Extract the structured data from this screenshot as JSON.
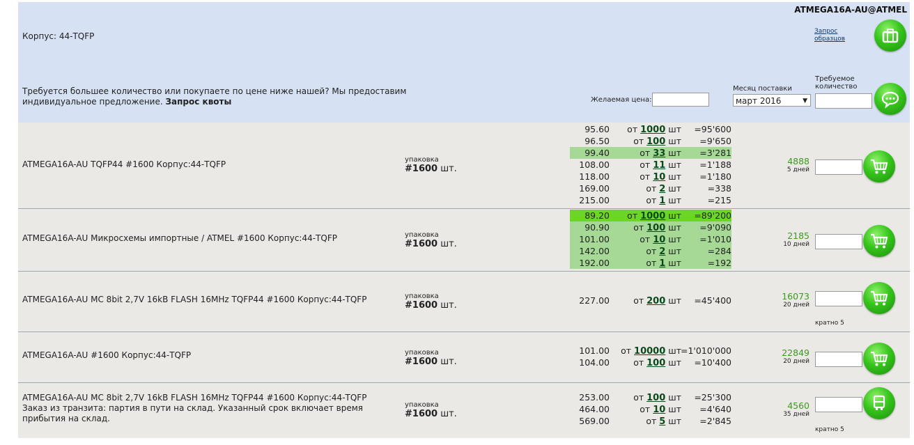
{
  "header": {
    "part_title": "ATMEGA16A-AU@ATMEL",
    "package": "Корпус: 44-TQFP",
    "samples_link_line1": "Запрос",
    "samples_link_line2": "образцов",
    "quote_text": "Требуется большее количество или покупаете по цене ниже нашей? Мы предоставим индивидуальное предложение.",
    "quote_link": "Запрос квоты",
    "desired_price_label": "Желаемая цена:",
    "delivery_month_label": "Месяц поставки",
    "delivery_month_value": "март 2016",
    "required_qty_label": "Требуемое количество"
  },
  "offers": [
    {
      "description": "ATMEGA16A-AU TQFP44 #1600 Корпус:44-TQFP",
      "pack_label": "упаковка",
      "pack_value": "#1600",
      "pack_unit": "шт.",
      "prices": [
        {
          "price": "95.60",
          "from": "от",
          "qty": "1000",
          "unit": "шт",
          "total": "=95'600"
        },
        {
          "price": "96.50",
          "from": "от",
          "qty": "100",
          "unit": "шт",
          "total": "=9'650"
        },
        {
          "price": "99.40",
          "from": "от",
          "qty": "33",
          "unit": "шт",
          "total": "=3'281"
        },
        {
          "price": "108.00",
          "from": "от",
          "qty": "11",
          "unit": "шт",
          "total": "=1'188"
        },
        {
          "price": "118.00",
          "from": "от",
          "qty": "10",
          "unit": "шт",
          "total": "=1'180"
        },
        {
          "price": "169.00",
          "from": "от",
          "qty": "2",
          "unit": "шт",
          "total": "=338"
        },
        {
          "price": "215.00",
          "from": "от",
          "qty": "1",
          "unit": "шт",
          "total": "=215"
        }
      ],
      "stock": "4888",
      "days": "5 дней",
      "multiple": ""
    },
    {
      "description": "ATMEGA16A-AU Микросхемы импортные / ATMEL #1600 Корпус:44-TQFP",
      "pack_label": "упаковка",
      "pack_value": "#1600",
      "pack_unit": "шт.",
      "prices": [
        {
          "price": "89.20",
          "from": "от",
          "qty": "1000",
          "unit": "шт",
          "total": "=89'200"
        },
        {
          "price": "90.90",
          "from": "от",
          "qty": "100",
          "unit": "шт",
          "total": "=9'090"
        },
        {
          "price": "101.00",
          "from": "от",
          "qty": "10",
          "unit": "шт",
          "total": "=1'010"
        },
        {
          "price": "142.00",
          "from": "от",
          "qty": "2",
          "unit": "шт",
          "total": "=284"
        },
        {
          "price": "192.00",
          "from": "от",
          "qty": "1",
          "unit": "шт",
          "total": "=192"
        }
      ],
      "stock": "2185",
      "days": "10 дней",
      "multiple": ""
    },
    {
      "description": "ATMEGA16A-AU MC 8bit 2,7V 16kB FLASH 16MHz TQFP44 #1600 Корпус:44-TQFP",
      "pack_label": "упаковка",
      "pack_value": "#1600",
      "pack_unit": "шт.",
      "prices": [
        {
          "price": "227.00",
          "from": "от",
          "qty": "200",
          "unit": "шт",
          "total": "=45'400"
        }
      ],
      "stock": "16073",
      "days": "20 дней",
      "multiple": "кратно 5"
    },
    {
      "description": "ATMEGA16A-AU #1600 Корпус:44-TQFP",
      "pack_label": "упаковка",
      "pack_value": "#1600",
      "pack_unit": "шт.",
      "prices": [
        {
          "price": "101.00",
          "from": "от",
          "qty": "10000",
          "unit": "шт",
          "total": "=1'010'000"
        },
        {
          "price": "104.00",
          "from": "от",
          "qty": "100",
          "unit": "шт",
          "total": "=10'400"
        }
      ],
      "stock": "22849",
      "days": "20 дней",
      "multiple": ""
    },
    {
      "description": "ATMEGA16A-AU MC 8bit 2,7V 16kB FLASH 16MHz TQFP44 #1600 Корпус:44-TQFP",
      "note": "Заказ из транзита: партия в пути на склад. Указанный срок включает время прибытия на склад.",
      "pack_label": "упаковка",
      "pack_value": "#1600",
      "pack_unit": "шт.",
      "prices": [
        {
          "price": "253.00",
          "from": "от",
          "qty": "100",
          "unit": "шт",
          "total": "=25'300"
        },
        {
          "price": "464.00",
          "from": "от",
          "qty": "10",
          "unit": "шт",
          "total": "=4'640"
        },
        {
          "price": "569.00",
          "from": "от",
          "qty": "5",
          "unit": "шт",
          "total": "=2'845"
        }
      ],
      "stock": "4560",
      "days": "35 дней",
      "multiple": "кратно 5"
    }
  ],
  "icons": {
    "samples_button": "suitcase-icon",
    "quote_button": "chat-bubble-icon",
    "cart_button": "shopping-cart-icon",
    "transit_button": "truck-icon"
  },
  "colors": {
    "header_bg": "#d6e2f3",
    "row_bg": "#eae9e5",
    "highlight": "#a6d896",
    "highlight_best": "#6bd626",
    "stock_text": "#3a9b1c",
    "button_green": "#36c41c"
  }
}
